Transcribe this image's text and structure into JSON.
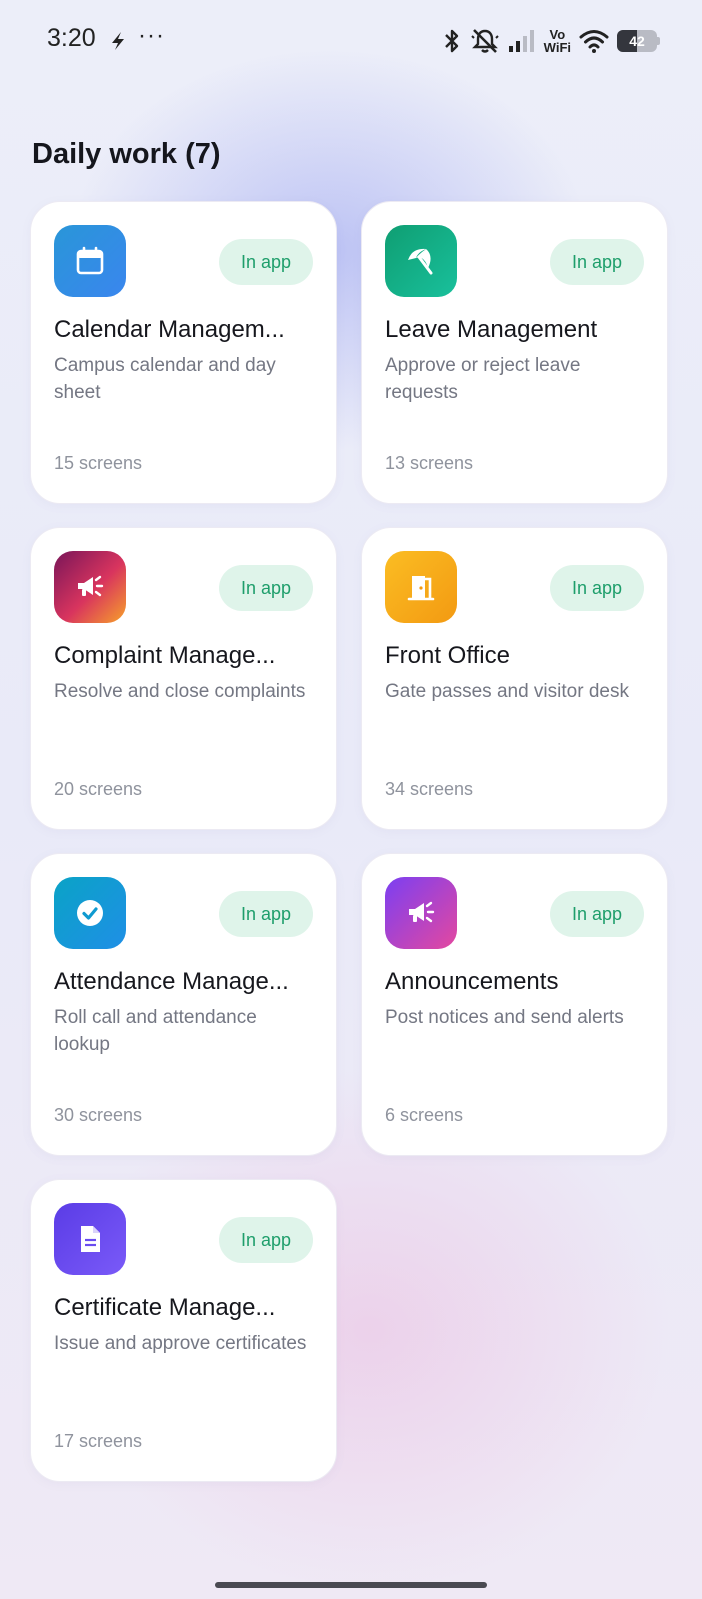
{
  "status_bar": {
    "time": "3:20",
    "overflow": "···",
    "vowifi_top": "Vo",
    "vowifi_bottom": "WiFi",
    "battery": "42",
    "icons": [
      "lightning-icon",
      "more-icon",
      "bluetooth-icon",
      "bell-muted-icon",
      "signal-icon",
      "vowifi-icon",
      "wifi-icon",
      "battery-icon"
    ]
  },
  "section": {
    "title": "Daily work (7)"
  },
  "cards": [
    {
      "title": "Calendar Managem...",
      "description": "Campus calendar and day sheet",
      "screens": "15 screens",
      "badge": "In app",
      "icon": "calendar-icon"
    },
    {
      "title": "Leave Management",
      "description": "Approve or reject leave requests",
      "screens": "13 screens",
      "badge": "In app",
      "icon": "beach-umbrella-icon"
    },
    {
      "title": "Complaint Manage...",
      "description": "Resolve and close complaints",
      "screens": "20 screens",
      "badge": "In app",
      "icon": "megaphone-icon"
    },
    {
      "title": "Front Office",
      "description": "Gate passes and visitor desk",
      "screens": "34 screens",
      "badge": "In app",
      "icon": "door-icon"
    },
    {
      "title": "Attendance Manage...",
      "description": "Roll call and attendance lookup",
      "screens": "30 screens",
      "badge": "In app",
      "icon": "check-circle-icon"
    },
    {
      "title": "Announcements",
      "description": "Post notices and send alerts",
      "screens": "6 screens",
      "badge": "In app",
      "icon": "megaphone-icon"
    },
    {
      "title": "Certificate Manage...",
      "description": "Issue and approve certificates",
      "screens": "17 screens",
      "badge": "In app",
      "icon": "document-icon"
    }
  ],
  "colors": {
    "badge_bg": "#dff4ea",
    "badge_text": "#1e9e6b",
    "card_bg": "#ffffff"
  }
}
